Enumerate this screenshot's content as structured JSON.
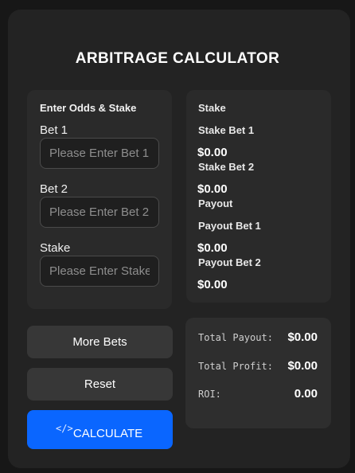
{
  "app": {
    "title": "ARBITRAGE CALCULATOR"
  },
  "inputs_panel": {
    "heading": "Enter Odds & Stake",
    "fields": [
      {
        "label": "Bet 1",
        "placeholder": "Please Enter Bet 1",
        "value": ""
      },
      {
        "label": "Bet 2",
        "placeholder": "Please Enter Bet 2",
        "value": ""
      },
      {
        "label": "Stake",
        "placeholder": "Please Enter Stake",
        "value": ""
      }
    ]
  },
  "results_panel": {
    "stake_heading": "Stake",
    "stake_bet_1_label": "Stake Bet 1",
    "stake_bet_1_value": "$0.00",
    "stake_bet_2_label": "Stake Bet 2",
    "stake_bet_2_value": "$0.00",
    "payout_heading": "Payout",
    "payout_bet_1_label": "Payout Bet 1",
    "payout_bet_1_value": "$0.00",
    "payout_bet_2_label": "Payout Bet 2",
    "payout_bet_2_value": "$0.00"
  },
  "buttons": {
    "more_bets": "More Bets",
    "reset": "Reset",
    "calculate": "CALCULATE",
    "calculate_icon": "code-icon",
    "calculate_icon_glyph": "</>"
  },
  "summary": {
    "total_payout_label": "Total Payout:",
    "total_payout_value": "$0.00",
    "total_profit_label": "Total Profit:",
    "total_profit_value": "$0.00",
    "roi_label": "ROI:",
    "roi_value": "0.00"
  },
  "colors": {
    "background": "#171717",
    "card": "#232323",
    "panel": "#2a2a2a",
    "accent_button": "#0a66ff",
    "secondary_button": "#373737"
  }
}
